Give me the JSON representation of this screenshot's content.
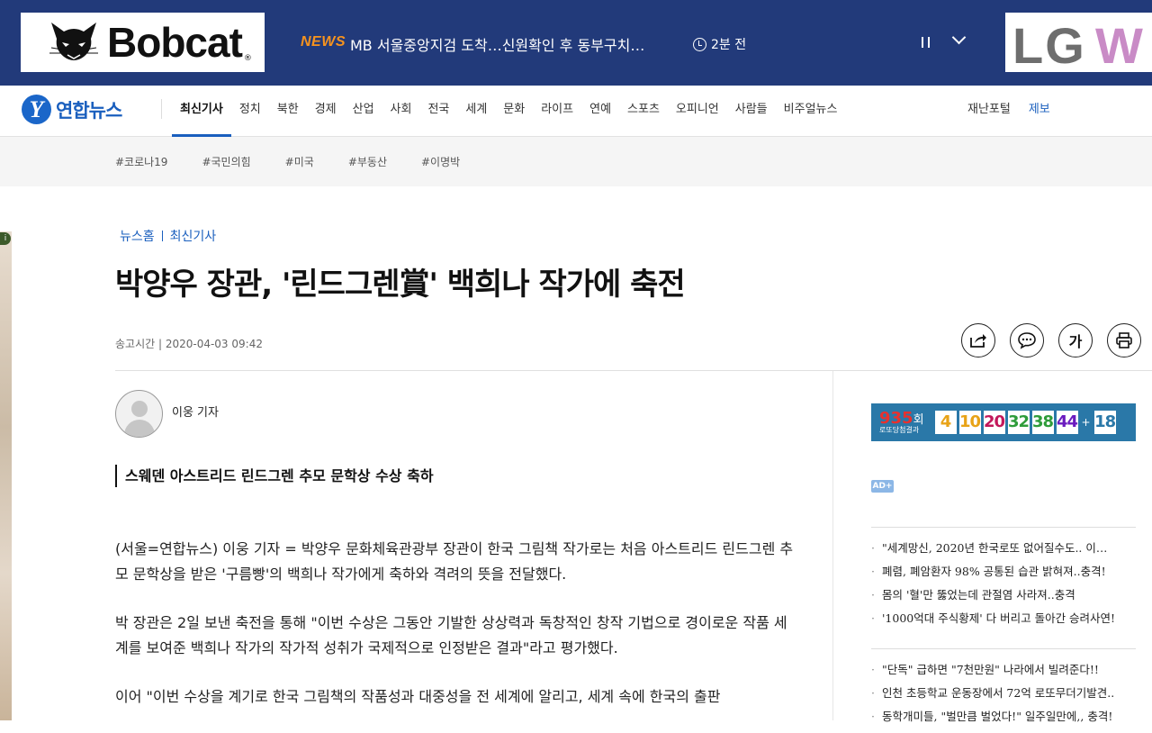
{
  "top_banner": {
    "left_ad_brand": "Bobcat",
    "left_ad_reg": "®",
    "news_label": "NEWS",
    "news_headline": "MB 서울중앙지검 도착…신원확인 후 동부구치…",
    "news_time": "2분 전",
    "right_ad_text": "LG",
    "right_ad_text2": "W"
  },
  "nav": {
    "logo_mark": "Y",
    "logo_text": "연합뉴스",
    "items": [
      "최신기사",
      "정치",
      "북한",
      "경제",
      "산업",
      "사회",
      "전국",
      "세계",
      "문화",
      "라이프",
      "연예",
      "스포츠",
      "오피니언",
      "사람들",
      "비주얼뉴스"
    ],
    "active": "최신기사",
    "right_items": [
      "재난포털",
      "제보"
    ]
  },
  "tags": [
    "#코로나19",
    "#국민의힘",
    "#미국",
    "#부동산",
    "#이명박"
  ],
  "article": {
    "breadcrumb": [
      "뉴스홈",
      "최신기사"
    ],
    "headline": "박양우 장관, '린드그렌賞' 백희나 작가에 축전",
    "published": "송고시간 | 2020-04-03 09:42",
    "tool_font_label": "가",
    "author": "이웅 기자",
    "subhead": "스웨덴 아스트리드 린드그렌 추모 문학상 수상 축하",
    "paragraphs": [
      "(서울=연합뉴스) 이웅 기자 = 박양우 문화체육관광부 장관이 한국 그림책 작가로는 처음 아스트리드 린드그렌 추모 문학상을 받은 '구름빵'의 백희나 작가에게 축하와 격려의 뜻을 전달했다.",
      "박 장관은 2일 보낸 축전을 통해 \"이번 수상은 그동안 기발한 상상력과 독창적인 창작 기법으로 경이로운 작품 세계를 보여준 백희나 작가의 작가적 성취가 국제적으로 인정받은 결과\"라고 평가했다.",
      "이어 \"이번 수상을 계기로 한국 그림책의 작품성과 대중성을 전 세계에 알리고, 세계 속에 한국의 출판"
    ]
  },
  "sidebar": {
    "lotto": {
      "round": "935",
      "round_suffix": "회",
      "caption": "로또당첨결과",
      "numbers": [
        "4",
        "10",
        "20",
        "32",
        "38",
        "44"
      ],
      "bonus": "18",
      "colors": [
        "#e8a317",
        "#e8a317",
        "#c2185b",
        "#2e9c3a",
        "#2e9c3a",
        "#6a1bbf",
        "#2a78a8"
      ]
    },
    "ad_badge": "AD+",
    "ads_1": [
      "\"세계망신, 2020년 한국로또 없어질수도.. 이…",
      "폐렴, 폐암환자 98% 공통된 습관 밝혀져..충격!",
      "몸의 '혈'만 뚫었는데 관절염 사라져..충격",
      "'1000억대 주식황제' 다 버리고 돌아간 승려사연!"
    ],
    "ads_2": [
      "\"단독\" 급하면 \"7천만원\" 나라에서 빌려준다!!",
      "인천 초등학교 운동장에서 72억 로또무더기발견..",
      "동학개미들, \"벌만큼 벌었다!\" 일주일만에,, 충격!"
    ]
  }
}
